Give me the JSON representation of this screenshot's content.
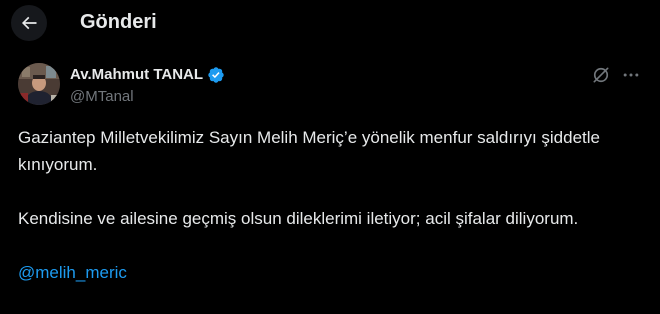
{
  "header": {
    "title": "Gönderi",
    "back_icon": "arrow-left-icon"
  },
  "author": {
    "display_name": "Av.Mahmut TANAL",
    "handle": "@MTanal",
    "verified": true,
    "verified_color": "#1d9bf0"
  },
  "actions": {
    "grok_icon": "grok-icon",
    "more_icon": "more-horizontal-icon"
  },
  "tweet": {
    "paragraph_1": "Gaziantep Milletvekilimiz Sayın Melih Meriç’e yönelik menfur saldırıyı şiddetle kınıyorum.",
    "paragraph_2": "Kendisine ve ailesine geçmiş olsun dileklerimi iletiyor; acil şifalar diliyorum.",
    "mention": "@melih_meric"
  },
  "colors": {
    "background": "#000000",
    "text_primary": "#e7e9ea",
    "text_secondary": "#71767b",
    "accent": "#1d9bf0"
  }
}
